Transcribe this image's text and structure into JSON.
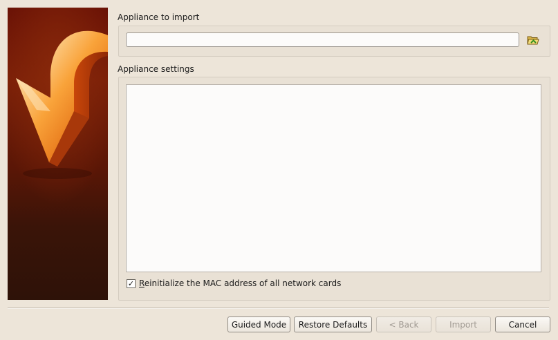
{
  "import": {
    "title": "Appliance to import",
    "path_value": "",
    "browse_icon": "folder-open-icon"
  },
  "settings": {
    "title": "Appliance settings",
    "reinit_mac_label": "Reinitialize the MAC address of all network cards",
    "reinit_mac_checked": true,
    "checkmark": "✓"
  },
  "buttons": {
    "guided_mode": "Guided Mode",
    "restore_defaults": "Restore Defaults",
    "back": "< Back",
    "import": "Import",
    "cancel": "Cancel"
  },
  "colors": {
    "window_bg": "#ede5d9",
    "banner_dark": "#3a1408",
    "arrow_orange": "#f7941d"
  }
}
